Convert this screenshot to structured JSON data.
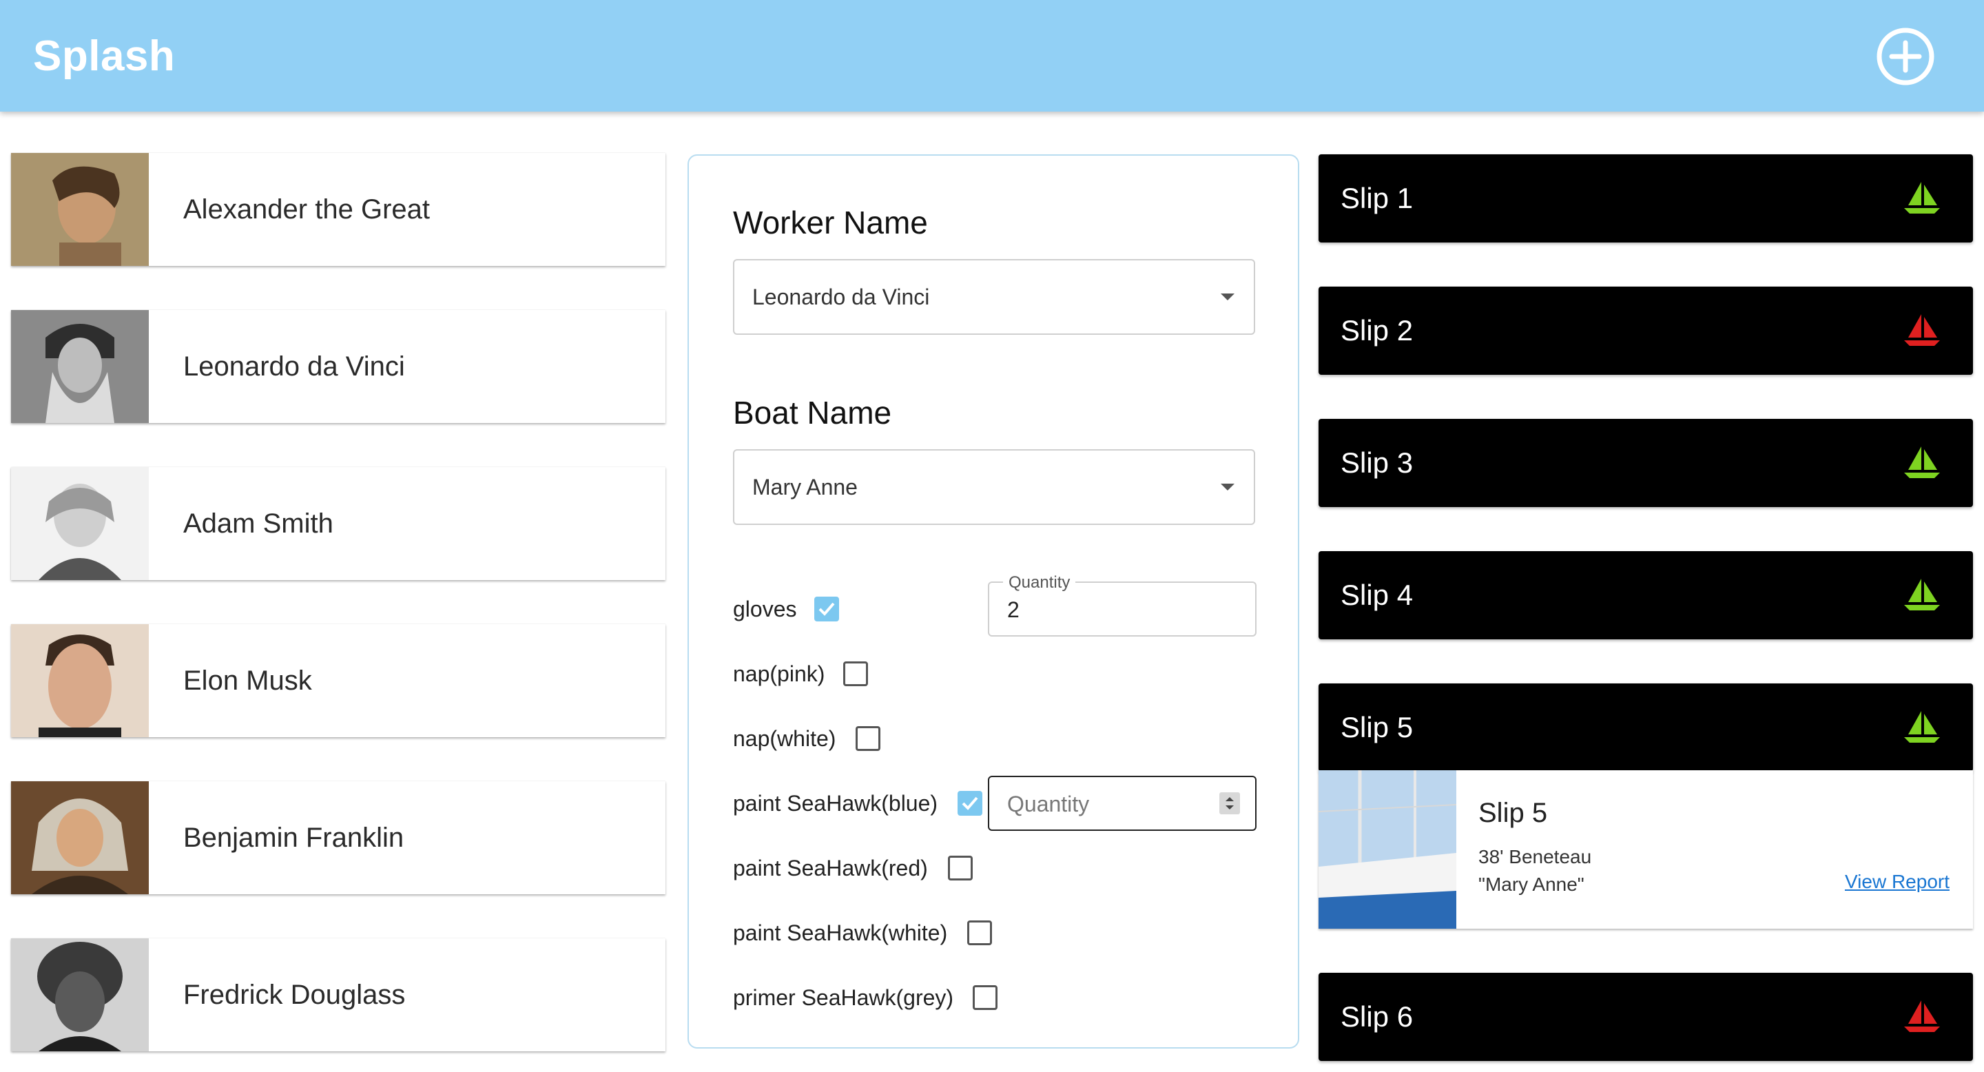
{
  "app": {
    "title": "Splash",
    "header_color": "#92d0f5"
  },
  "people": [
    {
      "name": "Alexander the Great"
    },
    {
      "name": "Leonardo da Vinci"
    },
    {
      "name": "Adam Smith"
    },
    {
      "name": "Elon Musk"
    },
    {
      "name": "Benjamin Franklin"
    },
    {
      "name": "Fredrick Douglass"
    }
  ],
  "form": {
    "worker_label": "Worker Name",
    "worker_value": "Leonardo da Vinci",
    "boat_label": "Boat Name",
    "boat_value": "Mary Anne",
    "supplies": [
      {
        "label": "gloves",
        "checked": true
      },
      {
        "label": "nap(pink)",
        "checked": false
      },
      {
        "label": "nap(white)",
        "checked": false
      },
      {
        "label": "paint SeaHawk(blue)",
        "checked": true
      },
      {
        "label": "paint SeaHawk(red)",
        "checked": false
      },
      {
        "label": "paint SeaHawk(white)",
        "checked": false
      },
      {
        "label": "primer SeaHawk(grey)",
        "checked": false
      }
    ],
    "gloves_qty_label": "Quantity",
    "gloves_qty_value": "2",
    "blue_qty_placeholder": "Quantity"
  },
  "slips": [
    {
      "label": "Slip 1",
      "status_color": "#7ed321"
    },
    {
      "label": "Slip 2",
      "status_color": "#e02020"
    },
    {
      "label": "Slip 3",
      "status_color": "#7ed321"
    },
    {
      "label": "Slip 4",
      "status_color": "#7ed321"
    },
    {
      "label": "Slip 5",
      "status_color": "#7ed321"
    },
    {
      "label": "Slip 6",
      "status_color": "#e02020"
    }
  ],
  "slip_detail": {
    "title": "Slip 5",
    "boat_desc": "38' Beneteau",
    "boat_name": "\"Mary Anne\"",
    "link": "View Report"
  },
  "icons": {
    "add": "plus-circle-icon",
    "boat": "sailboat-icon",
    "caret": "chevron-down-icon"
  }
}
